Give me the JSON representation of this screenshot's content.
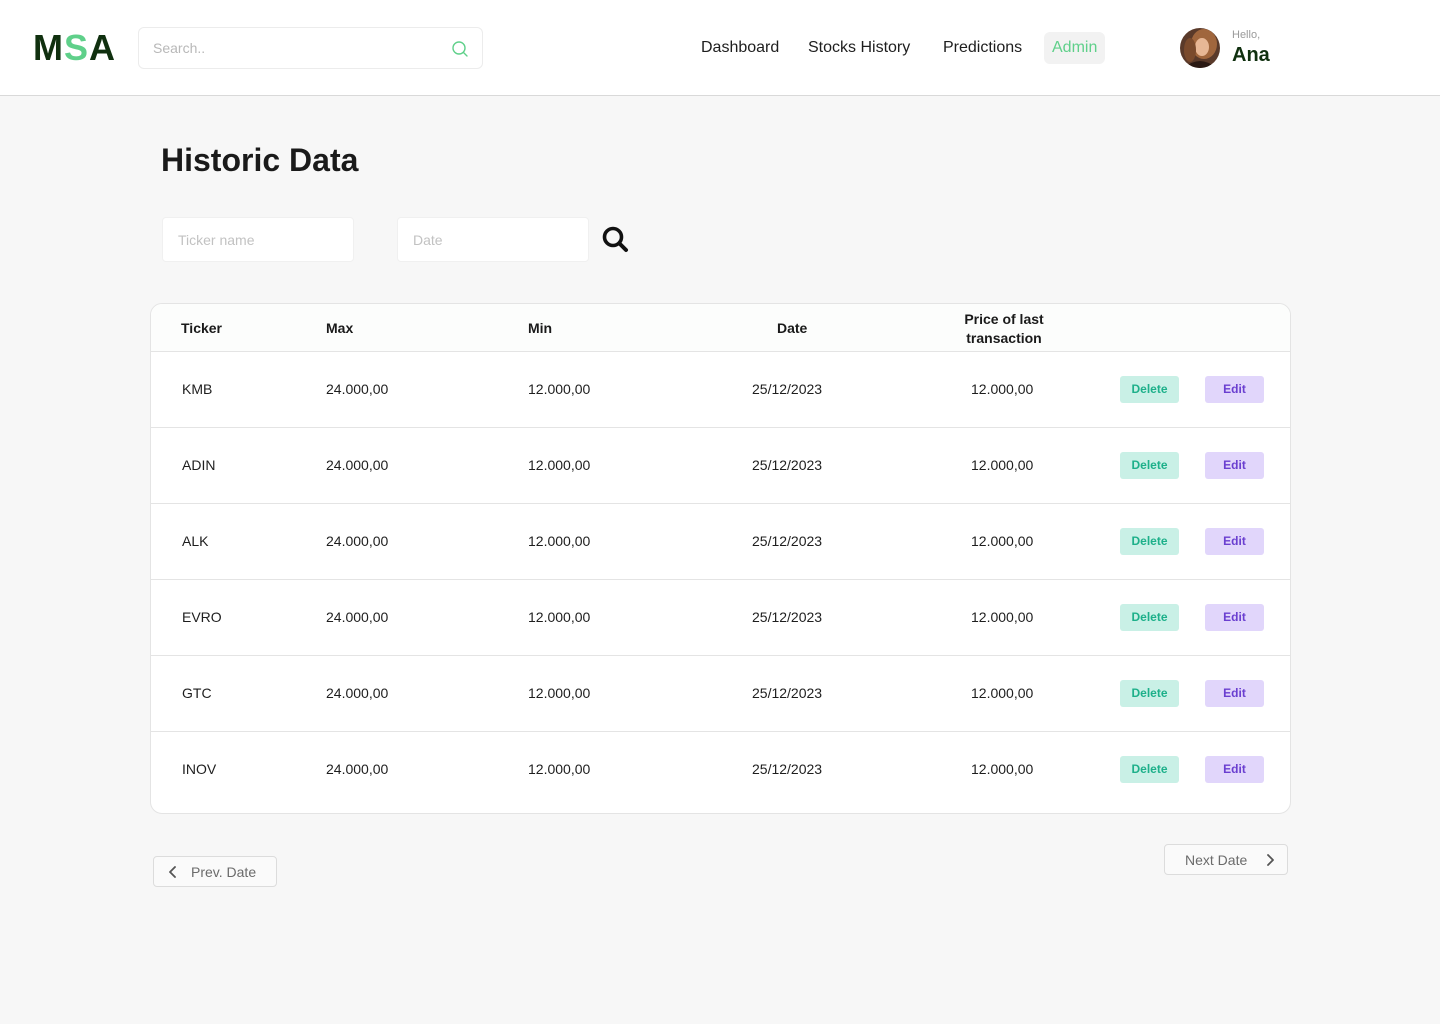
{
  "logo": {
    "part1": "M",
    "part2": "S",
    "part3": "A"
  },
  "header": {
    "search_placeholder": "Search..",
    "nav": [
      {
        "label": "Dashboard"
      },
      {
        "label": "Stocks History"
      },
      {
        "label": "Predictions"
      },
      {
        "label": "Admin"
      }
    ],
    "user": {
      "greeting": "Hello,",
      "name": "Ana"
    }
  },
  "colors": {
    "accent": "#5fd08a",
    "brand_dark": "#10300f",
    "delete": "#1db08a",
    "edit": "#6a3fd0"
  },
  "page": {
    "title": "Historic Data",
    "filters": {
      "ticker_placeholder": "Ticker name",
      "date_placeholder": "Date"
    }
  },
  "table": {
    "columns": [
      "Ticker",
      "Max",
      "Min",
      "Date",
      "Price of last",
      "transaction"
    ],
    "delete_label": "Delete",
    "edit_label": "Edit",
    "rows": [
      {
        "ticker": "KMB",
        "max": "24.000,00",
        "min": "12.000,00",
        "date": "25/12/2023",
        "last_price": "12.000,00"
      },
      {
        "ticker": "ADIN",
        "max": "24.000,00",
        "min": "12.000,00",
        "date": "25/12/2023",
        "last_price": "12.000,00"
      },
      {
        "ticker": "ALK",
        "max": "24.000,00",
        "min": "12.000,00",
        "date": "25/12/2023",
        "last_price": "12.000,00"
      },
      {
        "ticker": "EVRO",
        "max": "24.000,00",
        "min": "12.000,00",
        "date": "25/12/2023",
        "last_price": "12.000,00"
      },
      {
        "ticker": "GTC",
        "max": "24.000,00",
        "min": "12.000,00",
        "date": "25/12/2023",
        "last_price": "12.000,00"
      },
      {
        "ticker": "INOV",
        "max": "24.000,00",
        "min": "12.000,00",
        "date": "25/12/2023",
        "last_price": "12.000,00"
      }
    ]
  },
  "pagination": {
    "prev_label": "Prev. Date",
    "next_label": "Next Date"
  }
}
